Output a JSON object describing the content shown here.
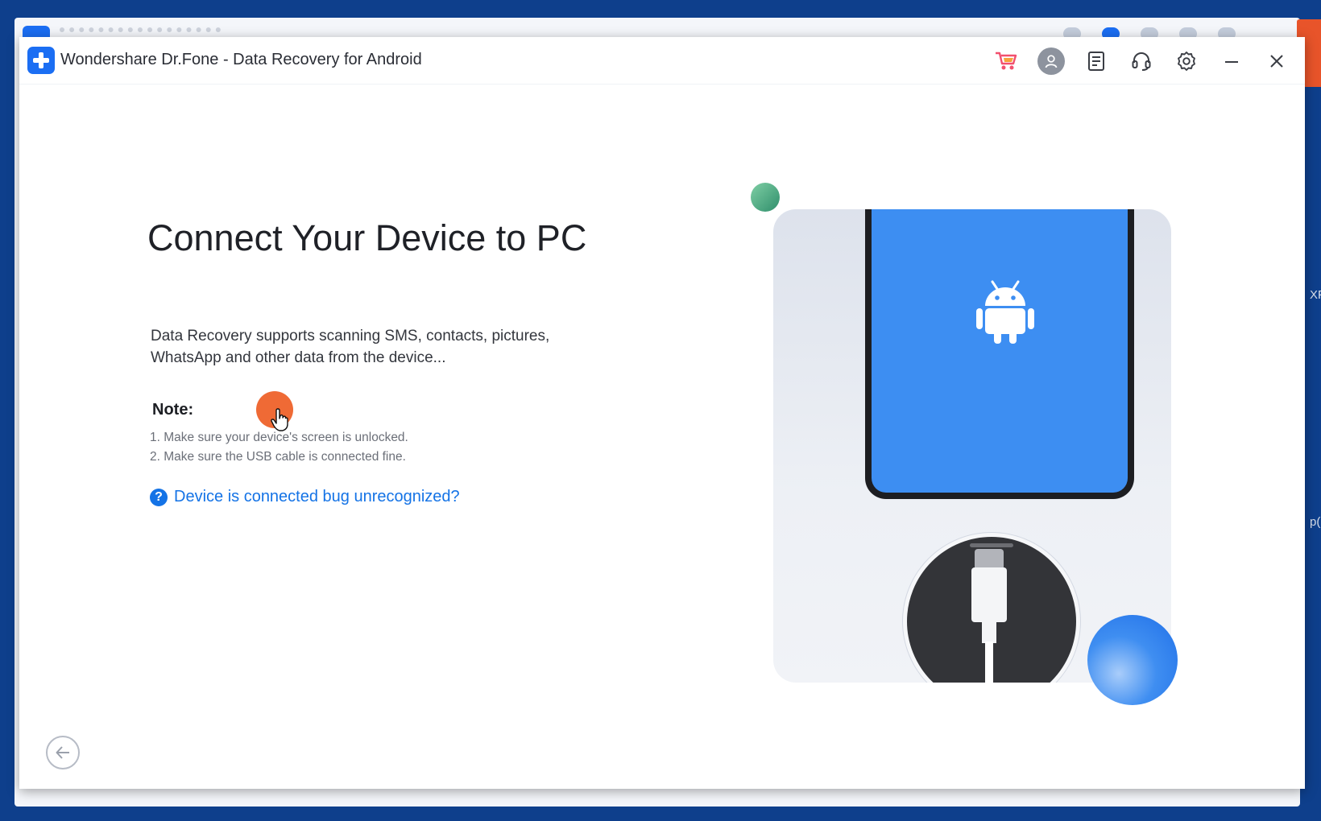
{
  "window": {
    "title": "Wondershare Dr.Fone - Data Recovery for Android"
  },
  "toolbar": {
    "icons": [
      "cart-icon",
      "user-icon",
      "feedback-icon",
      "support-icon",
      "settings-icon",
      "minimize-icon",
      "close-icon"
    ]
  },
  "main": {
    "title": "Connect Your Device to PC",
    "description": "Data Recovery supports scanning SMS, contacts, pictures, WhatsApp and other data from the device...",
    "note_title": "Note:",
    "notes": [
      "1. Make sure your device's screen is unlocked.",
      "2. Make sure the USB cable is connected fine."
    ],
    "help_icon": "?",
    "help_link": "Device is connected bug unrecognized?"
  },
  "side_text": {
    "a": "XP",
    "b": "p("
  },
  "colors": {
    "accent": "#1473e6",
    "brand": "#1b6ef3",
    "phone_screen": "#3d8ef2",
    "cursor_highlight": "#ef6a35"
  }
}
